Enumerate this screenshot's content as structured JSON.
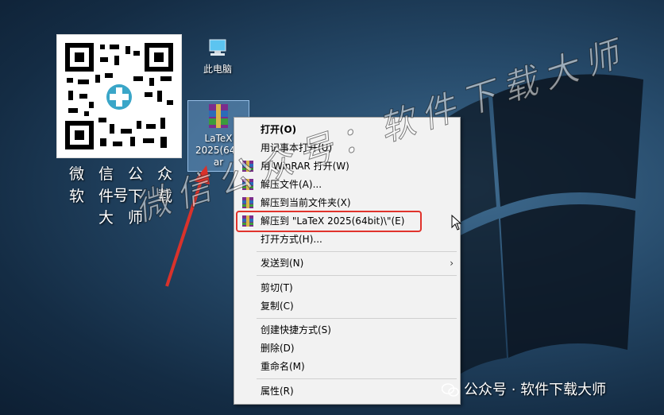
{
  "desktop": {
    "qr_caption_line1": "微 信 公 众 号",
    "qr_caption_line2": "软 件 下 载 大 师",
    "icons": [
      {
        "label": "此电脑"
      },
      {
        "label_line1": "LaTeX",
        "label_line2": "2025(64b",
        "label_line3": "ar"
      }
    ]
  },
  "context_menu": {
    "items": [
      {
        "label": "打开(O)",
        "bold": true
      },
      {
        "label": "用记事本打开(U)"
      },
      {
        "label": "用 WinRAR 打开(W)",
        "icon": "winrar-icon"
      },
      {
        "label": "解压文件(A)...",
        "icon": "winrar-icon"
      },
      {
        "label": "解压到当前文件夹(X)",
        "icon": "winrar-icon"
      },
      {
        "label": "解压到 \"LaTeX 2025(64bit)\\\"(E)",
        "icon": "winrar-icon",
        "highlighted": true
      },
      {
        "label": "打开方式(H)..."
      },
      {
        "label": "发送到(N)",
        "submenu": true
      },
      {
        "label": "剪切(T)"
      },
      {
        "label": "复制(C)"
      },
      {
        "label": "创建快捷方式(S)"
      },
      {
        "label": "删除(D)"
      },
      {
        "label": "重命名(M)"
      },
      {
        "label": "属性(R)"
      }
    ]
  },
  "watermark": {
    "text": "微信公众号：软件下载大师"
  },
  "footer": {
    "wechat_text": "公众号 · 软件下载大师"
  },
  "colors": {
    "highlight_border": "#e0332c",
    "arrow": "#d9322b",
    "menu_bg": "#f2f2f2"
  }
}
